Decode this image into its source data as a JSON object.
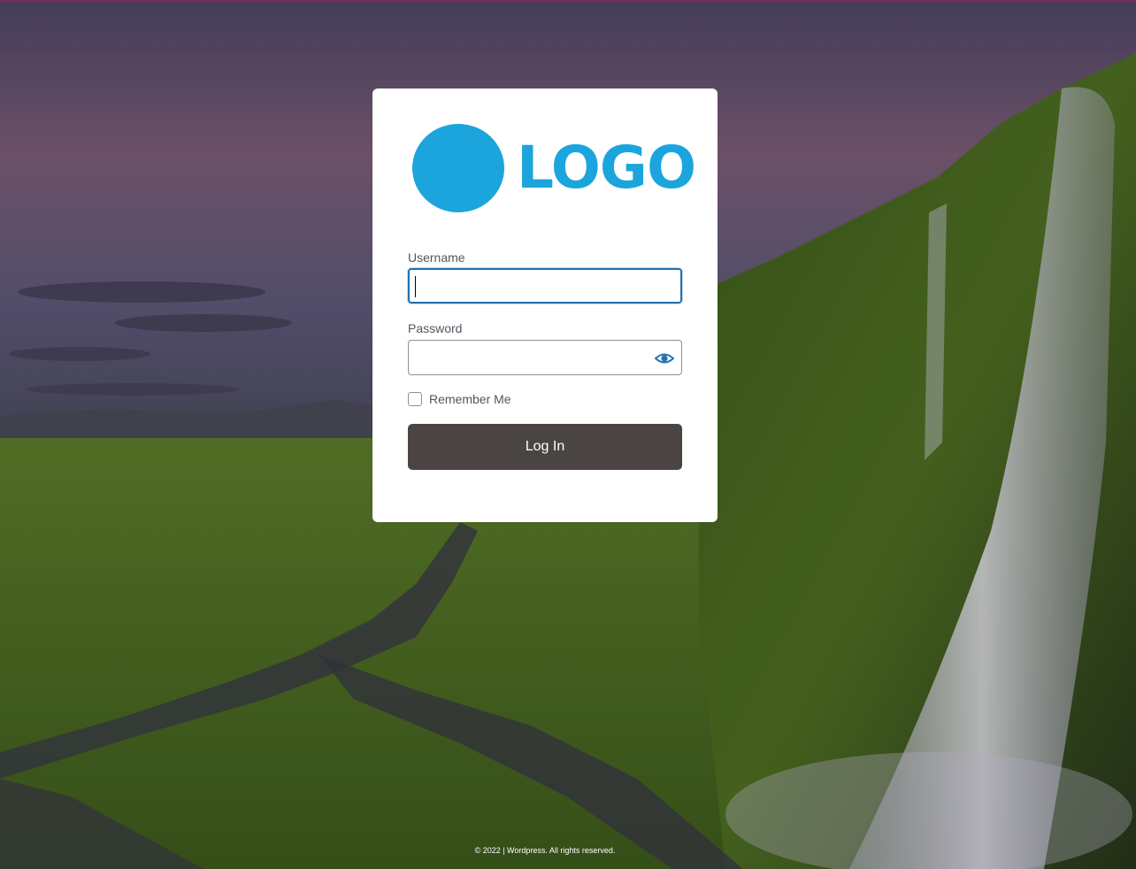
{
  "colors": {
    "logo_accent": "#1ba5dc",
    "button_bg": "#4a4543",
    "focus_border": "#2271b1"
  },
  "logo": {
    "text": "LOGO",
    "icon": "logo-circle"
  },
  "form": {
    "username_label": "Username",
    "username_value": "",
    "password_label": "Password",
    "password_value": "",
    "password_toggle_icon": "eye-icon",
    "remember_label": "Remember Me",
    "remember_checked": false,
    "submit_label": "Log In"
  },
  "footer": {
    "text": "© 2022 | Wordpress. All rights reserved."
  }
}
